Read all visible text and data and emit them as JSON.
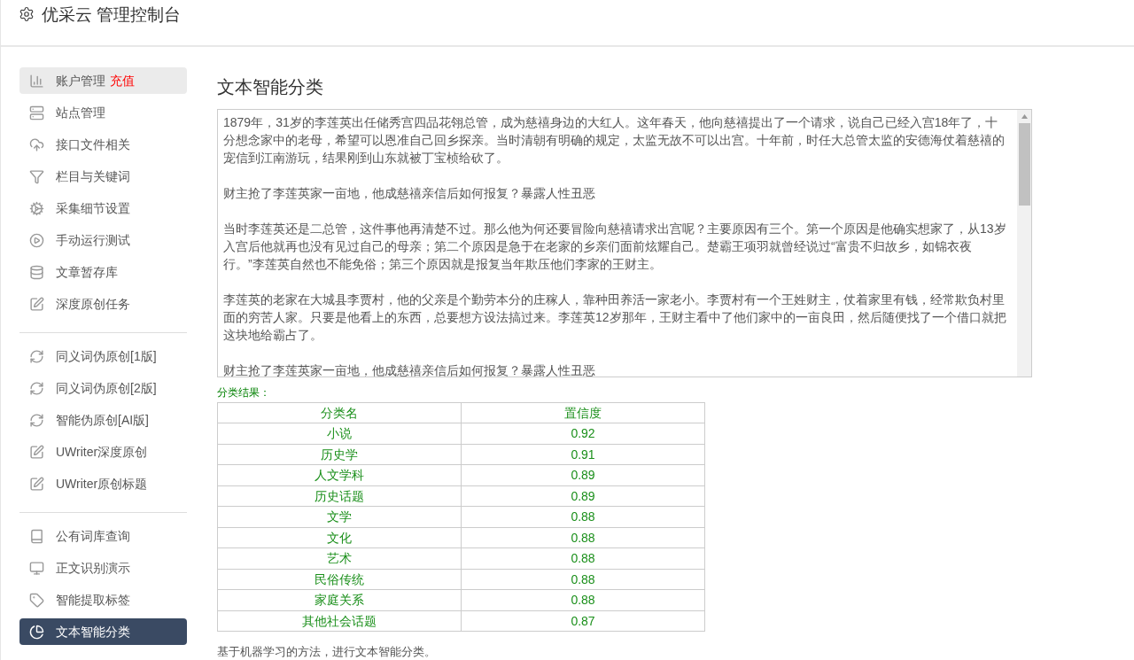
{
  "header": {
    "title": "优采云 管理控制台"
  },
  "sidebar": {
    "groups": [
      [
        {
          "label": "账户管理",
          "badge": "充值",
          "selected": false,
          "highlighted": true
        },
        {
          "label": "站点管理",
          "selected": false
        },
        {
          "label": "接口文件相关",
          "selected": false
        },
        {
          "label": "栏目与关键词",
          "selected": false
        },
        {
          "label": "采集细节设置",
          "selected": false
        },
        {
          "label": "手动运行测试",
          "selected": false
        },
        {
          "label": "文章暂存库",
          "selected": false
        },
        {
          "label": "深度原创任务",
          "selected": false
        }
      ],
      [
        {
          "label": "同义词伪原创[1版]",
          "selected": false
        },
        {
          "label": "同义词伪原创[2版]",
          "selected": false
        },
        {
          "label": "智能伪原创[AI版]",
          "selected": false
        },
        {
          "label": "UWriter深度原创",
          "selected": false
        },
        {
          "label": "UWriter原创标题",
          "selected": false
        }
      ],
      [
        {
          "label": "公有词库查询",
          "selected": false
        },
        {
          "label": "正文识别演示",
          "selected": false
        },
        {
          "label": "智能提取标签",
          "selected": false
        },
        {
          "label": "文本智能分类",
          "selected": true
        }
      ]
    ]
  },
  "main": {
    "title": "文本智能分类",
    "text_input": {
      "paragraphs": [
        "1879年，31岁的李莲英出任储秀宫四品花翎总管，成为慈禧身边的大红人。这年春天，他向慈禧提出了一个请求，说自己已经入宫18年了，十分想念家中的老母，希望可以恩准自己回乡探亲。当时清朝有明确的规定，太监无故不可以出宫。十年前，时任大总管太监的安德海仗着慈禧的宠信到江南游玩，结果刚到山东就被丁宝桢给砍了。",
        "财主抢了李莲英家一亩地，他成慈禧亲信后如何报复？暴露人性丑恶",
        "当时李莲英还是二总管，这件事他再清楚不过。那么他为何还要冒险向慈禧请求出宫呢？主要原因有三个。第一个原因是他确实想家了，从13岁入宫后他就再也没有见过自己的母亲；第二个原因是急于在老家的乡亲们面前炫耀自己。楚霸王项羽就曾经说过“富贵不归故乡，如锦衣夜行。”李莲英自然也不能免俗；第三个原因就是报复当年欺压他们李家的王财主。",
        "李莲英的老家在大城县李贾村，他的父亲是个勤劳本分的庄稼人，靠种田养活一家老小。李贾村有一个王姓财主，仗着家里有钱，经常欺负村里面的穷苦人家。只要是他看上的东西，总要想方设法搞过来。李莲英12岁那年，王财主看中了他们家中的一亩良田，然后随便找了一个借口就把这块地给霸占了。",
        "财主抢了李莲英家一亩地，他成慈禧亲信后如何报复？暴露人性丑恶"
      ]
    },
    "result_label": "分类结果：",
    "table": {
      "columns": [
        "分类名",
        "置信度"
      ],
      "rows": [
        [
          "小说",
          "0.92"
        ],
        [
          "历史学",
          "0.91"
        ],
        [
          "人文学科",
          "0.89"
        ],
        [
          "历史话题",
          "0.89"
        ],
        [
          "文学",
          "0.88"
        ],
        [
          "文化",
          "0.88"
        ],
        [
          "艺术",
          "0.88"
        ],
        [
          "民俗传统",
          "0.88"
        ],
        [
          "家庭关系",
          "0.88"
        ],
        [
          "其他社会话题",
          "0.87"
        ]
      ]
    },
    "footnote": "基于机器学习的方法，进行文本智能分类。"
  }
}
